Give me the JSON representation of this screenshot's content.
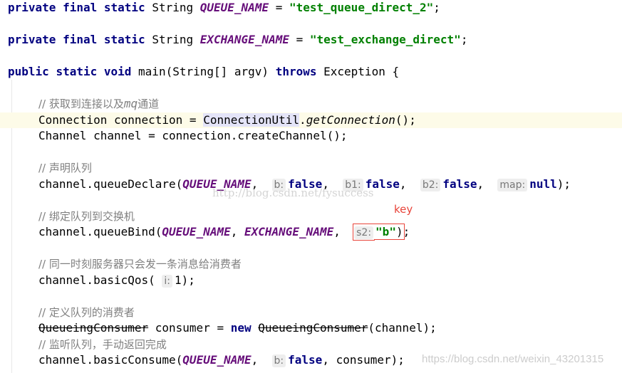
{
  "code_lines": [
    {
      "row": 0,
      "indent": 0,
      "tokens": [
        [
          "private",
          "kw"
        ],
        [
          " ",
          ""
        ],
        [
          "final",
          "kw"
        ],
        [
          " ",
          ""
        ],
        [
          "static",
          "kw"
        ],
        [
          " String ",
          ""
        ],
        [
          "QUEUE_NAME",
          "const"
        ],
        [
          " = ",
          ""
        ],
        [
          "\"test_queue_direct_2\"",
          "str"
        ],
        [
          ";",
          ""
        ]
      ]
    },
    {
      "row": 2,
      "indent": 0,
      "tokens": [
        [
          "private",
          "kw"
        ],
        [
          " ",
          ""
        ],
        [
          "final",
          "kw"
        ],
        [
          " ",
          ""
        ],
        [
          "static",
          "kw"
        ],
        [
          " String ",
          ""
        ],
        [
          "EXCHANGE_NAME",
          "const"
        ],
        [
          " = ",
          ""
        ],
        [
          "\"test_exchange_direct\"",
          "str"
        ],
        [
          ";",
          ""
        ]
      ]
    },
    {
      "row": 4,
      "indent": 0,
      "tokens": [
        [
          "public",
          "kw"
        ],
        [
          " ",
          ""
        ],
        [
          "static",
          "kw"
        ],
        [
          " ",
          ""
        ],
        [
          "void",
          "kw"
        ],
        [
          " main(String[] argv) ",
          ""
        ],
        [
          "throws",
          "kw"
        ],
        [
          " Exception {",
          ""
        ]
      ]
    },
    {
      "row": 6,
      "indent": 1,
      "tokens": [
        [
          "// 获取到连接以及",
          "cm"
        ],
        [
          "mq",
          "cmi"
        ],
        [
          "通道",
          "cm"
        ]
      ]
    },
    {
      "row": 7,
      "indent": 1,
      "highlight": true,
      "tokens": [
        [
          "Connection connection = ",
          ""
        ],
        [
          "ConnectionUtil",
          "sel"
        ],
        [
          ".",
          ""
        ],
        [
          "getConnection",
          "it"
        ],
        [
          "();",
          ""
        ]
      ]
    },
    {
      "row": 8,
      "indent": 1,
      "tokens": [
        [
          "Channel channel = connection.createChannel();",
          ""
        ]
      ]
    },
    {
      "row": 10,
      "indent": 1,
      "tokens": [
        [
          "// 声明队列",
          "cm"
        ]
      ]
    },
    {
      "row": 11,
      "indent": 1,
      "tokens": [
        [
          "channel.queueDeclare(",
          ""
        ],
        [
          "QUEUE_NAME",
          "const"
        ],
        [
          ",  ",
          ""
        ],
        [
          "b:",
          "hint"
        ],
        [
          "false",
          "kw"
        ],
        [
          ",  ",
          ""
        ],
        [
          "b1:",
          "hint"
        ],
        [
          "false",
          "kw"
        ],
        [
          ",  ",
          ""
        ],
        [
          "b2:",
          "hint"
        ],
        [
          "false",
          "kw"
        ],
        [
          ",  ",
          ""
        ],
        [
          "map:",
          "hint"
        ],
        [
          "null",
          "kw"
        ],
        [
          ");",
          ""
        ]
      ]
    },
    {
      "row": 13,
      "indent": 1,
      "tokens": [
        [
          "// 绑定队列到交换机",
          "cm"
        ]
      ]
    },
    {
      "row": 14,
      "indent": 1,
      "tokens": [
        [
          "channel.queueBind(",
          ""
        ],
        [
          "QUEUE_NAME",
          "const"
        ],
        [
          ", ",
          ""
        ],
        [
          "EXCHANGE_NAME",
          "const"
        ],
        [
          ",  ",
          ""
        ],
        [
          "s2:|\"b\"|)",
          "box"
        ],
        [
          ";",
          ""
        ]
      ]
    },
    {
      "row": 16,
      "indent": 1,
      "tokens": [
        [
          "// 同一时刻服务器只会发一条消息给消费者",
          "cm"
        ]
      ]
    },
    {
      "row": 17,
      "indent": 1,
      "tokens": [
        [
          "channel.basicQos( ",
          ""
        ],
        [
          "i:",
          "hint"
        ],
        [
          "1",
          ""
        ],
        [
          ");",
          ""
        ]
      ]
    },
    {
      "row": 19,
      "indent": 1,
      "tokens": [
        [
          "// 定义队列的消费者",
          "cm"
        ]
      ]
    },
    {
      "row": 20,
      "indent": 1,
      "tokens": [
        [
          "QueueingConsumer",
          "dep"
        ],
        [
          " consumer = ",
          ""
        ],
        [
          "new",
          "kw"
        ],
        [
          " ",
          ""
        ],
        [
          "QueueingConsumer",
          "dep"
        ],
        [
          "(channel);",
          ""
        ]
      ]
    },
    {
      "row": 21,
      "indent": 1,
      "tokens": [
        [
          "// 监听队列，手动返回完成",
          "cm"
        ]
      ]
    },
    {
      "row": 22,
      "indent": 1,
      "tokens": [
        [
          "channel.basicConsume(",
          ""
        ],
        [
          "QUEUE_NAME",
          "const"
        ],
        [
          ",  ",
          ""
        ],
        [
          "b:",
          "hint"
        ],
        [
          "false",
          "kw"
        ],
        [
          ", consumer);",
          ""
        ]
      ]
    }
  ],
  "annotation": {
    "key_label": "key",
    "color": "#e8443a"
  },
  "watermarks": {
    "center": "http://blog.csdn.net/fysuccess",
    "bottom_right": "https://blog.csdn.net/weixin_43201315"
  },
  "colors": {
    "keyword": "#000080",
    "constant": "#660e7a",
    "string": "#008000",
    "comment": "#808080",
    "current_line": "#fdfbe8"
  }
}
